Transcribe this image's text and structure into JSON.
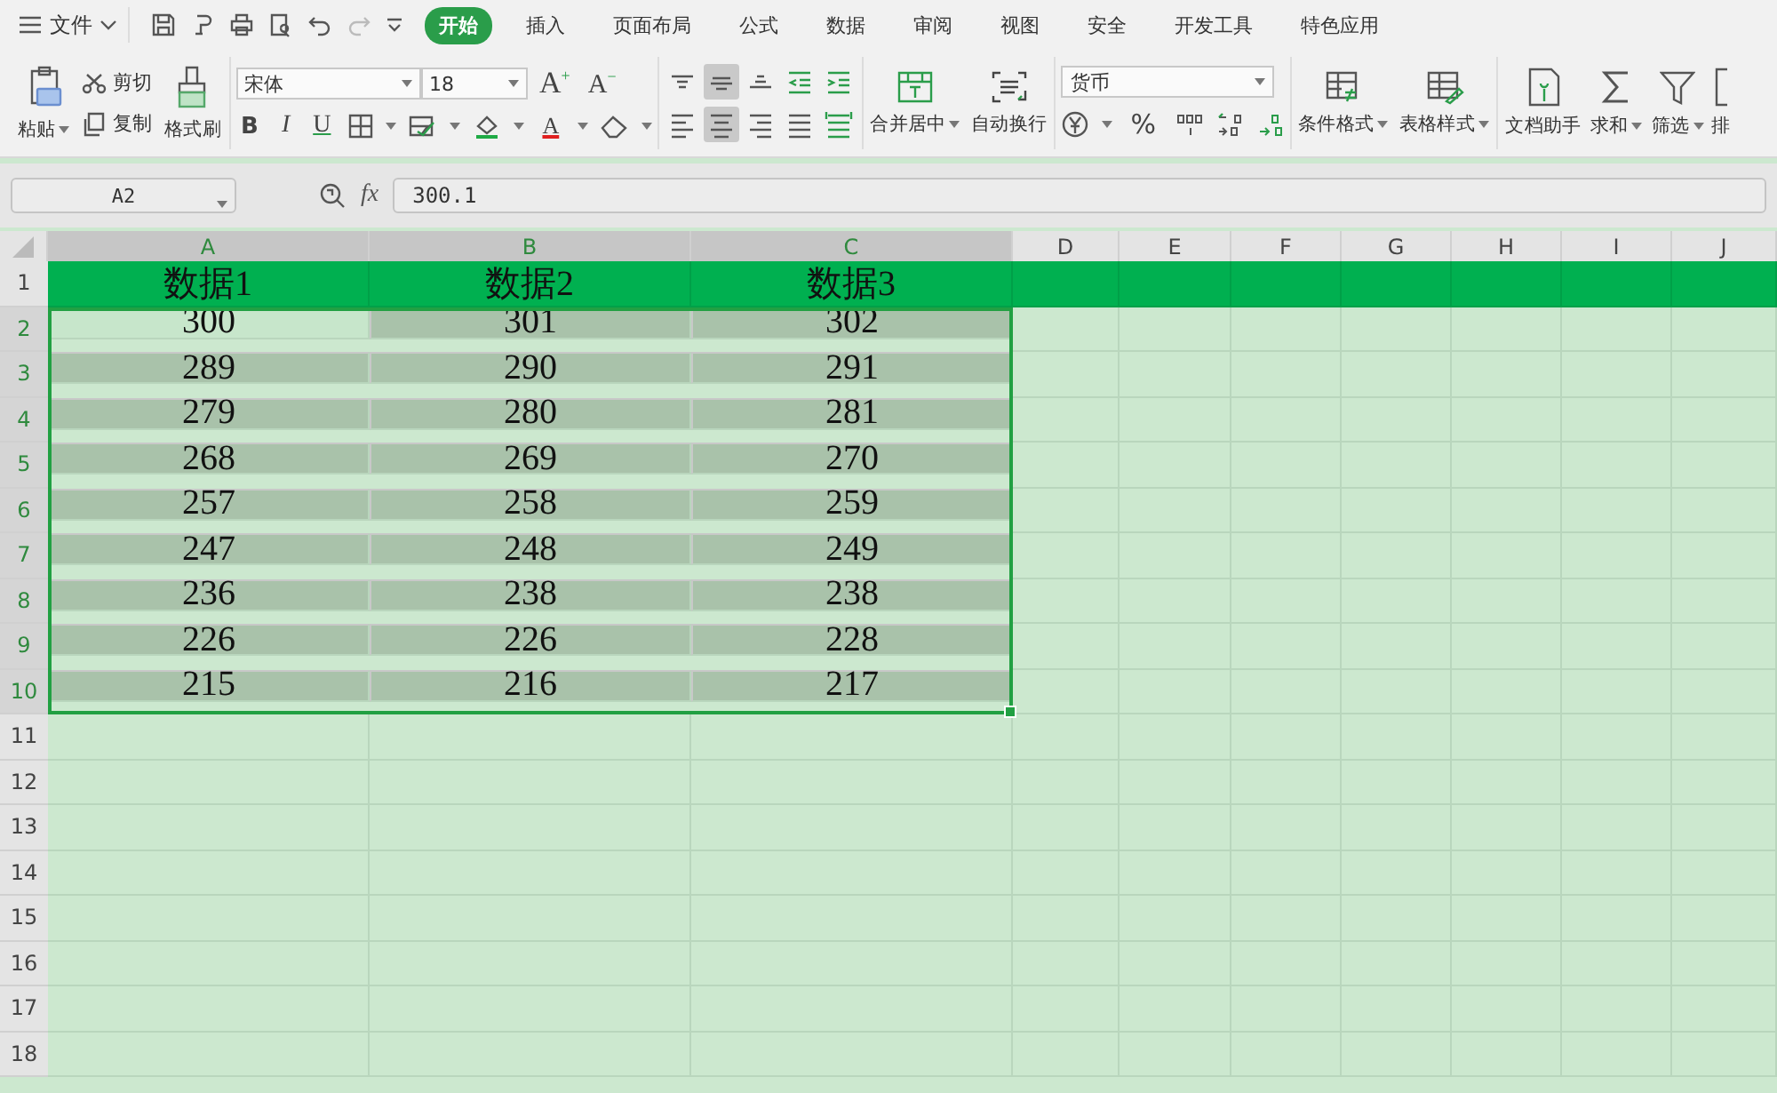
{
  "menu_bar": {
    "file_menu": "文件",
    "tabs": [
      {
        "label": "开始",
        "selected": true
      },
      {
        "label": "插入",
        "selected": false
      },
      {
        "label": "页面布局",
        "selected": false
      },
      {
        "label": "公式",
        "selected": false
      },
      {
        "label": "数据",
        "selected": false
      },
      {
        "label": "审阅",
        "selected": false
      },
      {
        "label": "视图",
        "selected": false
      },
      {
        "label": "安全",
        "selected": false
      },
      {
        "label": "开发工具",
        "selected": false
      },
      {
        "label": "特色应用",
        "selected": false
      }
    ]
  },
  "ribbon": {
    "clipboard": {
      "paste": "粘贴",
      "cut": "剪切",
      "copy": "复制",
      "format_painter": "格式刷"
    },
    "font": {
      "name": "宋体",
      "size": "18",
      "grow": "A",
      "grow_mark": "+",
      "shrink": "A",
      "shrink_mark": "−",
      "bold": "B",
      "italic": "I",
      "underline": "U",
      "font_color": "A"
    },
    "alignment": [
      {
        "kind": "top",
        "selected": false
      },
      {
        "kind": "middle",
        "selected": true
      },
      {
        "kind": "bottom",
        "selected": false
      },
      {
        "kind": "outdent",
        "selected": false
      },
      {
        "kind": "indent",
        "selected": false
      },
      {
        "kind": "left",
        "selected": false
      },
      {
        "kind": "center",
        "selected": true
      },
      {
        "kind": "right",
        "selected": false
      },
      {
        "kind": "justify",
        "selected": false
      },
      {
        "kind": "distribute",
        "selected": false
      }
    ],
    "merge": "合并居中",
    "wrap": "自动换行",
    "number": {
      "format": "货币",
      "percent": "%"
    },
    "styles": {
      "conditional": "条件格式",
      "table_style": "表格样式"
    },
    "tools": {
      "assistant": "文档助手",
      "sum": "求和",
      "filter": "筛选",
      "sort": "排"
    }
  },
  "formula_bar": {
    "name_box": "A2",
    "fx": "fx",
    "value": "300.1"
  },
  "sheet": {
    "columns": [
      {
        "label": "A",
        "selected": true
      },
      {
        "label": "B",
        "selected": true
      },
      {
        "label": "C",
        "selected": true
      },
      {
        "label": "D",
        "selected": false
      },
      {
        "label": "E",
        "selected": false
      },
      {
        "label": "F",
        "selected": false
      },
      {
        "label": "G",
        "selected": false
      },
      {
        "label": "H",
        "selected": false
      },
      {
        "label": "I",
        "selected": false
      },
      {
        "label": "J",
        "selected": false
      }
    ],
    "rows": [
      {
        "header": "1",
        "kind": "header",
        "selected": false,
        "cells": [
          {
            "text": "数据1",
            "selected": false,
            "active": false
          },
          {
            "text": "数据2",
            "selected": false,
            "active": false
          },
          {
            "text": "数据3",
            "selected": false,
            "active": false
          }
        ]
      },
      {
        "header": "2",
        "kind": "data",
        "selected": true,
        "cells": [
          {
            "text": "300",
            "selected": true,
            "active": true
          },
          {
            "text": "301",
            "selected": true,
            "active": false
          },
          {
            "text": "302",
            "selected": true,
            "active": false
          }
        ]
      },
      {
        "header": "3",
        "kind": "data",
        "selected": true,
        "cells": [
          {
            "text": "289",
            "selected": true,
            "active": false
          },
          {
            "text": "290",
            "selected": true,
            "active": false
          },
          {
            "text": "291",
            "selected": true,
            "active": false
          }
        ]
      },
      {
        "header": "4",
        "kind": "data",
        "selected": true,
        "cells": [
          {
            "text": "279",
            "selected": true,
            "active": false
          },
          {
            "text": "280",
            "selected": true,
            "active": false
          },
          {
            "text": "281",
            "selected": true,
            "active": false
          }
        ]
      },
      {
        "header": "5",
        "kind": "data",
        "selected": true,
        "cells": [
          {
            "text": "268",
            "selected": true,
            "active": false
          },
          {
            "text": "269",
            "selected": true,
            "active": false
          },
          {
            "text": "270",
            "selected": true,
            "active": false
          }
        ]
      },
      {
        "header": "6",
        "kind": "data",
        "selected": true,
        "cells": [
          {
            "text": "257",
            "selected": true,
            "active": false
          },
          {
            "text": "258",
            "selected": true,
            "active": false
          },
          {
            "text": "259",
            "selected": true,
            "active": false
          }
        ]
      },
      {
        "header": "7",
        "kind": "data",
        "selected": true,
        "cells": [
          {
            "text": "247",
            "selected": true,
            "active": false
          },
          {
            "text": "248",
            "selected": true,
            "active": false
          },
          {
            "text": "249",
            "selected": true,
            "active": false
          }
        ]
      },
      {
        "header": "8",
        "kind": "data",
        "selected": true,
        "cells": [
          {
            "text": "236",
            "selected": true,
            "active": false
          },
          {
            "text": "238",
            "selected": true,
            "active": false
          },
          {
            "text": "238",
            "selected": true,
            "active": false
          }
        ]
      },
      {
        "header": "9",
        "kind": "data",
        "selected": true,
        "cells": [
          {
            "text": "226",
            "selected": true,
            "active": false
          },
          {
            "text": "226",
            "selected": true,
            "active": false
          },
          {
            "text": "228",
            "selected": true,
            "active": false
          }
        ]
      },
      {
        "header": "10",
        "kind": "data",
        "selected": true,
        "cells": [
          {
            "text": "215",
            "selected": true,
            "active": false
          },
          {
            "text": "216",
            "selected": true,
            "active": false
          },
          {
            "text": "217",
            "selected": true,
            "active": false
          }
        ]
      },
      {
        "header": "11",
        "kind": "empty",
        "selected": false
      },
      {
        "header": "12",
        "kind": "empty",
        "selected": false
      },
      {
        "header": "13",
        "kind": "empty",
        "selected": false
      },
      {
        "header": "14",
        "kind": "empty",
        "selected": false
      },
      {
        "header": "15",
        "kind": "empty",
        "selected": false
      },
      {
        "header": "16",
        "kind": "empty",
        "selected": false
      },
      {
        "header": "17",
        "kind": "empty",
        "selected": false
      },
      {
        "header": "18",
        "kind": "empty",
        "selected": false
      }
    ]
  }
}
